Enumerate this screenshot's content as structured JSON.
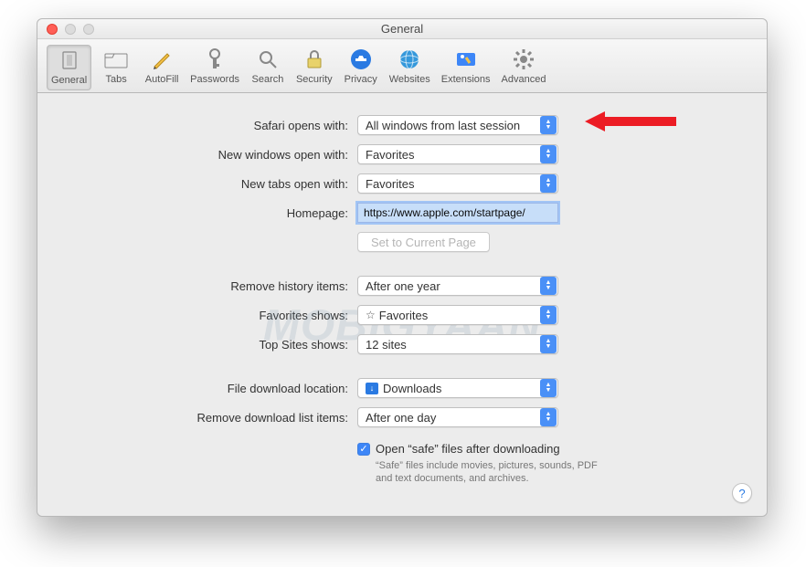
{
  "window": {
    "title": "General"
  },
  "toolbar": {
    "items": [
      {
        "label": "General"
      },
      {
        "label": "Tabs"
      },
      {
        "label": "AutoFill"
      },
      {
        "label": "Passwords"
      },
      {
        "label": "Search"
      },
      {
        "label": "Security"
      },
      {
        "label": "Privacy"
      },
      {
        "label": "Websites"
      },
      {
        "label": "Extensions"
      },
      {
        "label": "Advanced"
      }
    ]
  },
  "form": {
    "safari_opens_label": "Safari opens with:",
    "safari_opens_value": "All windows from last session",
    "new_windows_label": "New windows open with:",
    "new_windows_value": "Favorites",
    "new_tabs_label": "New tabs open with:",
    "new_tabs_value": "Favorites",
    "homepage_label": "Homepage:",
    "homepage_value": "https://www.apple.com/startpage/",
    "set_current_label": "Set to Current Page",
    "remove_history_label": "Remove history items:",
    "remove_history_value": "After one year",
    "favorites_shows_label": "Favorites shows:",
    "favorites_shows_value": "Favorites",
    "top_sites_label": "Top Sites shows:",
    "top_sites_value": "12 sites",
    "download_loc_label": "File download location:",
    "download_loc_value": "Downloads",
    "remove_dl_label": "Remove download list items:",
    "remove_dl_value": "After one day",
    "safe_files_label": "Open “safe” files after downloading",
    "safe_files_help": "“Safe” files include movies, pictures, sounds, PDF and text documents, and archives."
  },
  "watermark": "MOBIGYAAN",
  "help": "?"
}
